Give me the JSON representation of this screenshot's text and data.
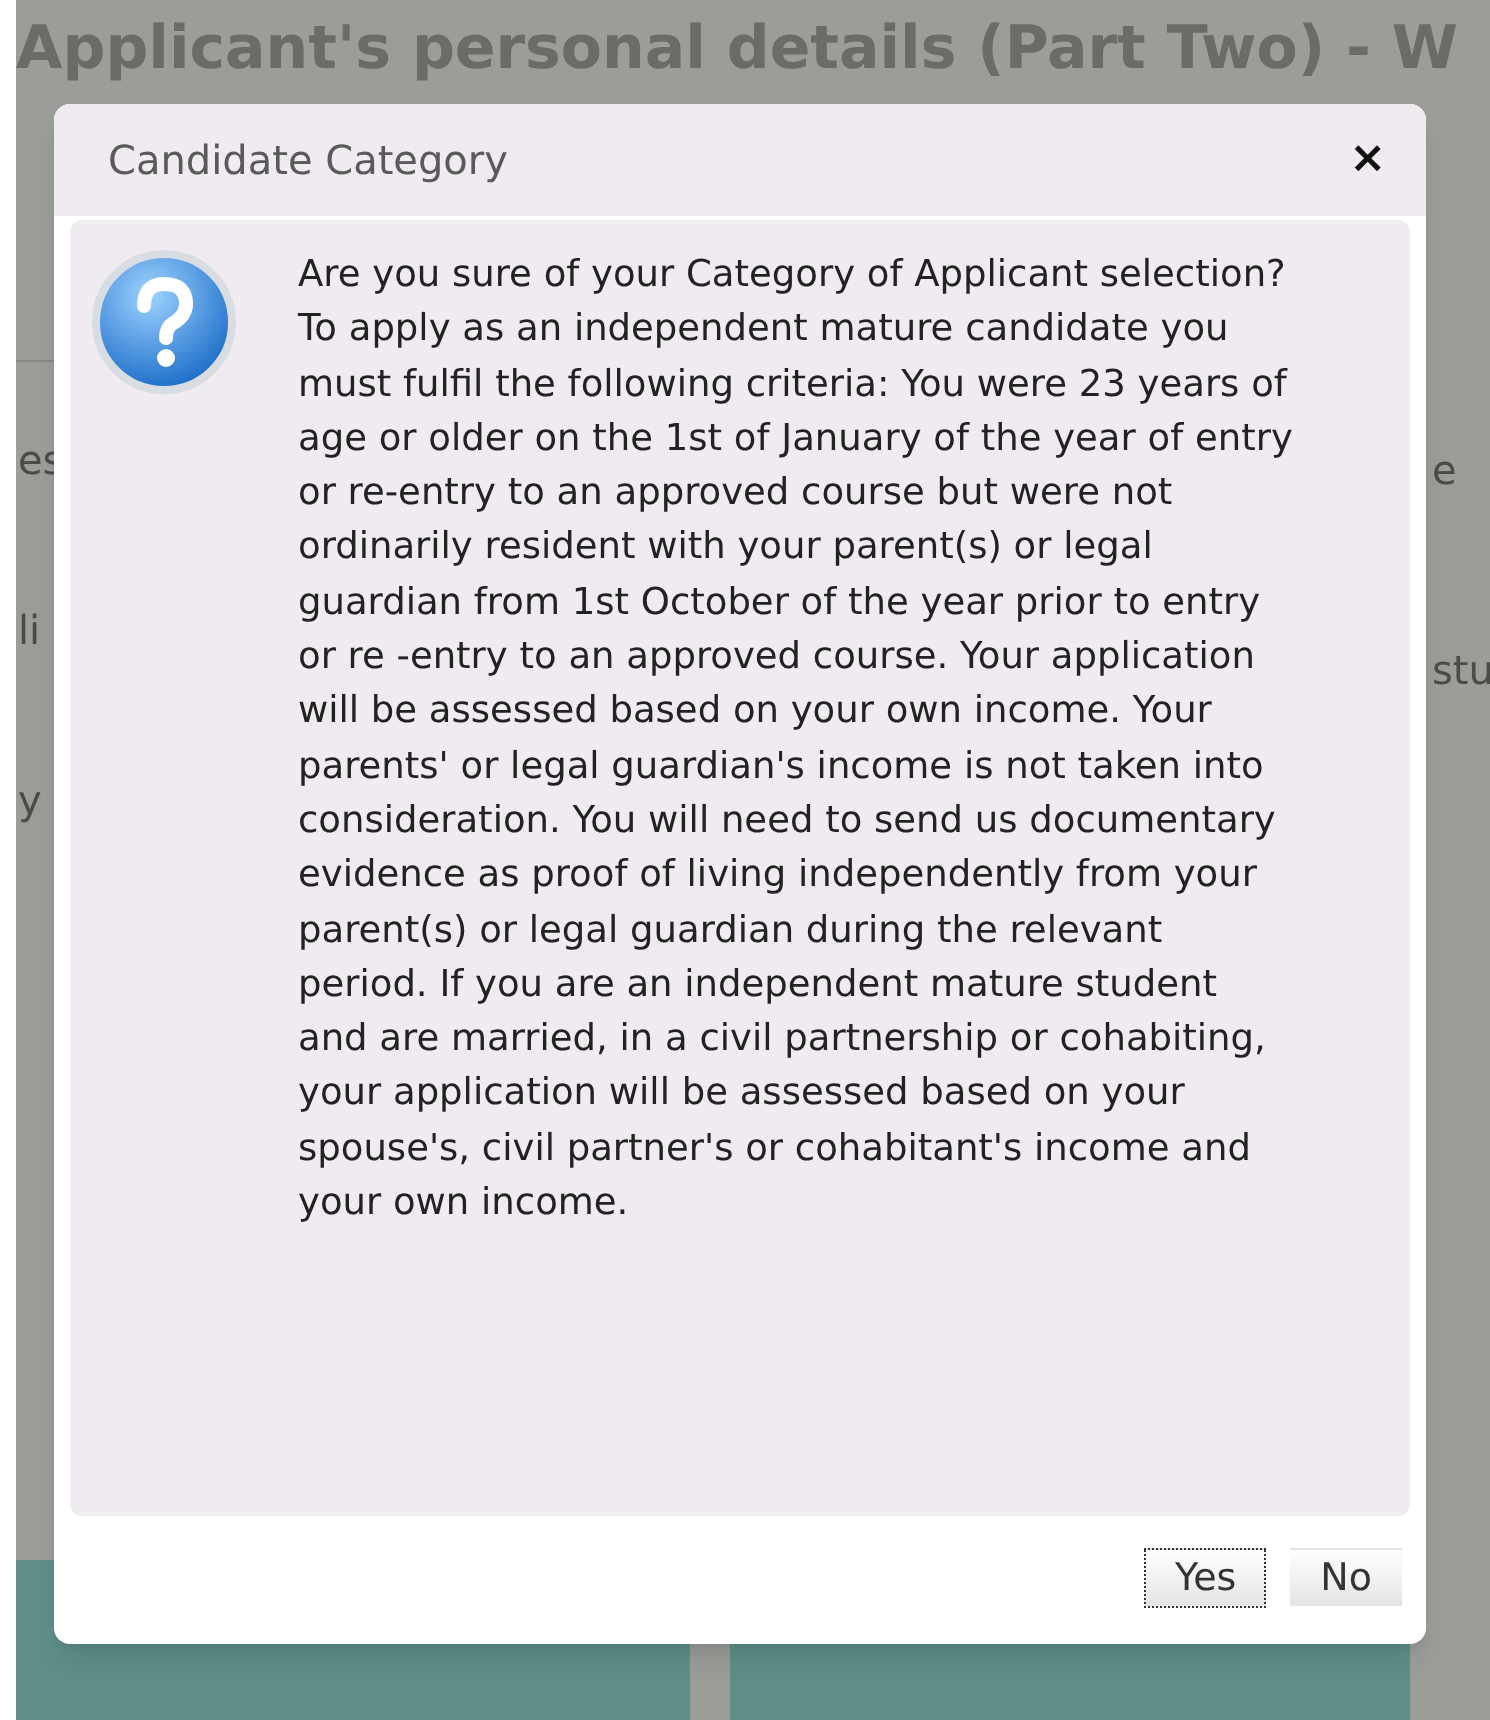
{
  "page": {
    "title": "Applicant's personal details (Part Two) - W",
    "left_fragments": [
      "es",
      "li",
      "y"
    ],
    "right_fragments": [
      "e",
      "stu"
    ]
  },
  "dialog": {
    "title": "Candidate Category",
    "close": "×",
    "message": "Are you sure of your Category of Applicant selection? To apply as an independent mature candidate you must fulfil the following criteria: You were 23 years of age or older on the 1st of January of the year of entry or re-entry to an approved course but were not ordinarily resident with your parent(s) or legal guardian from 1st October of the year prior to entry or re -entry to an approved course. Your application will be assessed based on your own income. Your parents' or legal guardian's income is not taken into consideration. You will need to send us documentary evidence as proof of living independently from your parent(s) or legal guardian during the relevant period. If you are an independent mature student and are married, in a civil partnership or cohabiting, your application will be assessed based on your spouse's, civil partner's or cohabitant's income and your own income.",
    "buttons": [
      {
        "label": "Yes",
        "selected": true
      },
      {
        "label": "No",
        "selected": false
      }
    ]
  }
}
